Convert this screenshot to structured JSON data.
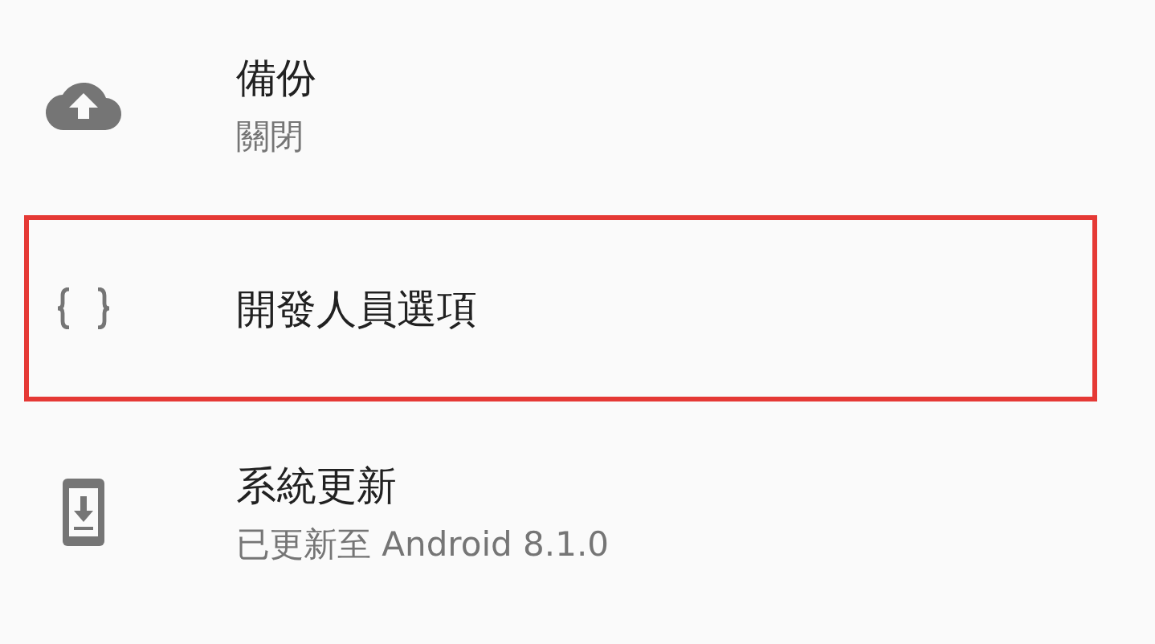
{
  "settings": [
    {
      "kind": "cloud",
      "title": "備份",
      "summary": "關閉",
      "highlighted": false
    },
    {
      "kind": "braces",
      "title": "開發人員選項",
      "highlighted": true
    },
    {
      "kind": "phone",
      "title": "系統更新",
      "summary": "已更新至 Android 8.1.0",
      "highlighted": false
    }
  ]
}
